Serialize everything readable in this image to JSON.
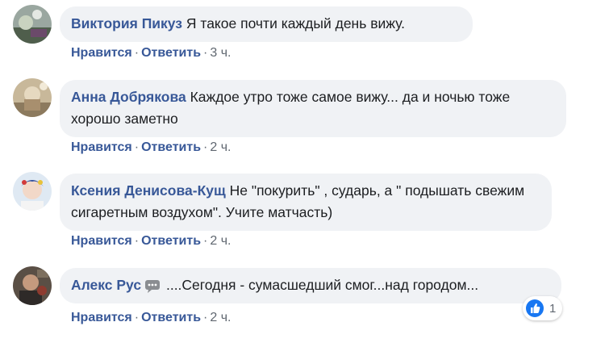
{
  "comments": [
    {
      "author": "Виктория Пикуз",
      "text": "Я такое почти каждый день вижу.",
      "like_label": "Нравится",
      "reply_label": "Ответить",
      "time": "3 ч."
    },
    {
      "author": "Анна Добрякова",
      "text": "Каждое утро тоже самое вижу... да и ночью тоже хорошо заметно",
      "like_label": "Нравится",
      "reply_label": "Ответить",
      "time": "2 ч."
    },
    {
      "author": "Ксения Денисова-Кущ",
      "text": "Не \"покурить\" , сударь, а \" подышать свежим сигаретным воздухом\". Учите матчасть)",
      "like_label": "Нравится",
      "reply_label": "Ответить",
      "time": "2 ч."
    },
    {
      "author": "Алекс Рус",
      "text": "....Сегодня - сумасшедший смог...над городом...",
      "like_label": "Нравится",
      "reply_label": "Ответить",
      "time": "2 ч.",
      "reaction_count": "1"
    }
  ],
  "separator": "·",
  "colors": {
    "author": "#385898",
    "bubble_bg": "#f0f2f5",
    "meta": "#606770",
    "like_blue": "#1877f2"
  }
}
